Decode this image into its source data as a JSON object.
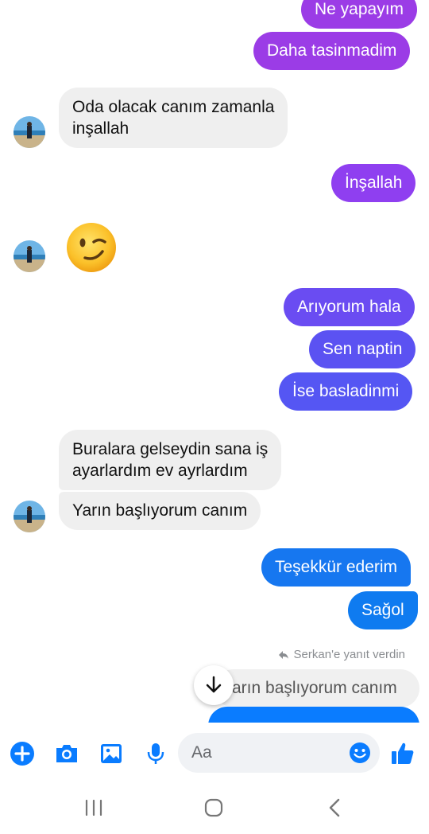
{
  "messages": [
    {
      "text": "Ne yapayım",
      "side": "out",
      "color": "#9b3ce6"
    },
    {
      "text": "Daha tasinmadim",
      "side": "out",
      "color": "#9b3ce6"
    },
    {
      "text": "Oda olacak canım zamanla\ninşallah",
      "side": "in"
    },
    {
      "text": "İnşallah",
      "side": "out",
      "color": "#8f3ff0"
    },
    {
      "text": "😉",
      "side": "in",
      "type": "emoji"
    },
    {
      "text": "Arıyorum hala",
      "side": "out",
      "color": "#6a4cf2"
    },
    {
      "text": "Sen naptin",
      "side": "out",
      "color": "#5b52f2"
    },
    {
      "text": "İse basladinmi",
      "side": "out",
      "color": "#5556f3"
    },
    {
      "text": "Buralara gelseydin sana iş\nayarlardım ev ayrlardım",
      "side": "in"
    },
    {
      "text": "Yarın başlıyorum canım",
      "side": "in"
    },
    {
      "text": "Teşekkür ederim",
      "side": "out",
      "color": "#1677f0"
    },
    {
      "text": "Sağol",
      "side": "out",
      "color": "#0f7bf0"
    }
  ],
  "reply": {
    "note": "Serkan'e yanıt verdin",
    "quoted": "arın başlıyorum canım",
    "partial_color": "#0a7cff"
  },
  "composer": {
    "placeholder": "Aa",
    "icons": [
      "plus-icon",
      "camera-icon",
      "gallery-icon",
      "microphone-icon",
      "emoji-icon",
      "like-icon"
    ],
    "accent": "#0a7cff"
  },
  "navbar": {
    "icons": [
      "recent-apps-icon",
      "home-icon",
      "back-icon"
    ]
  }
}
